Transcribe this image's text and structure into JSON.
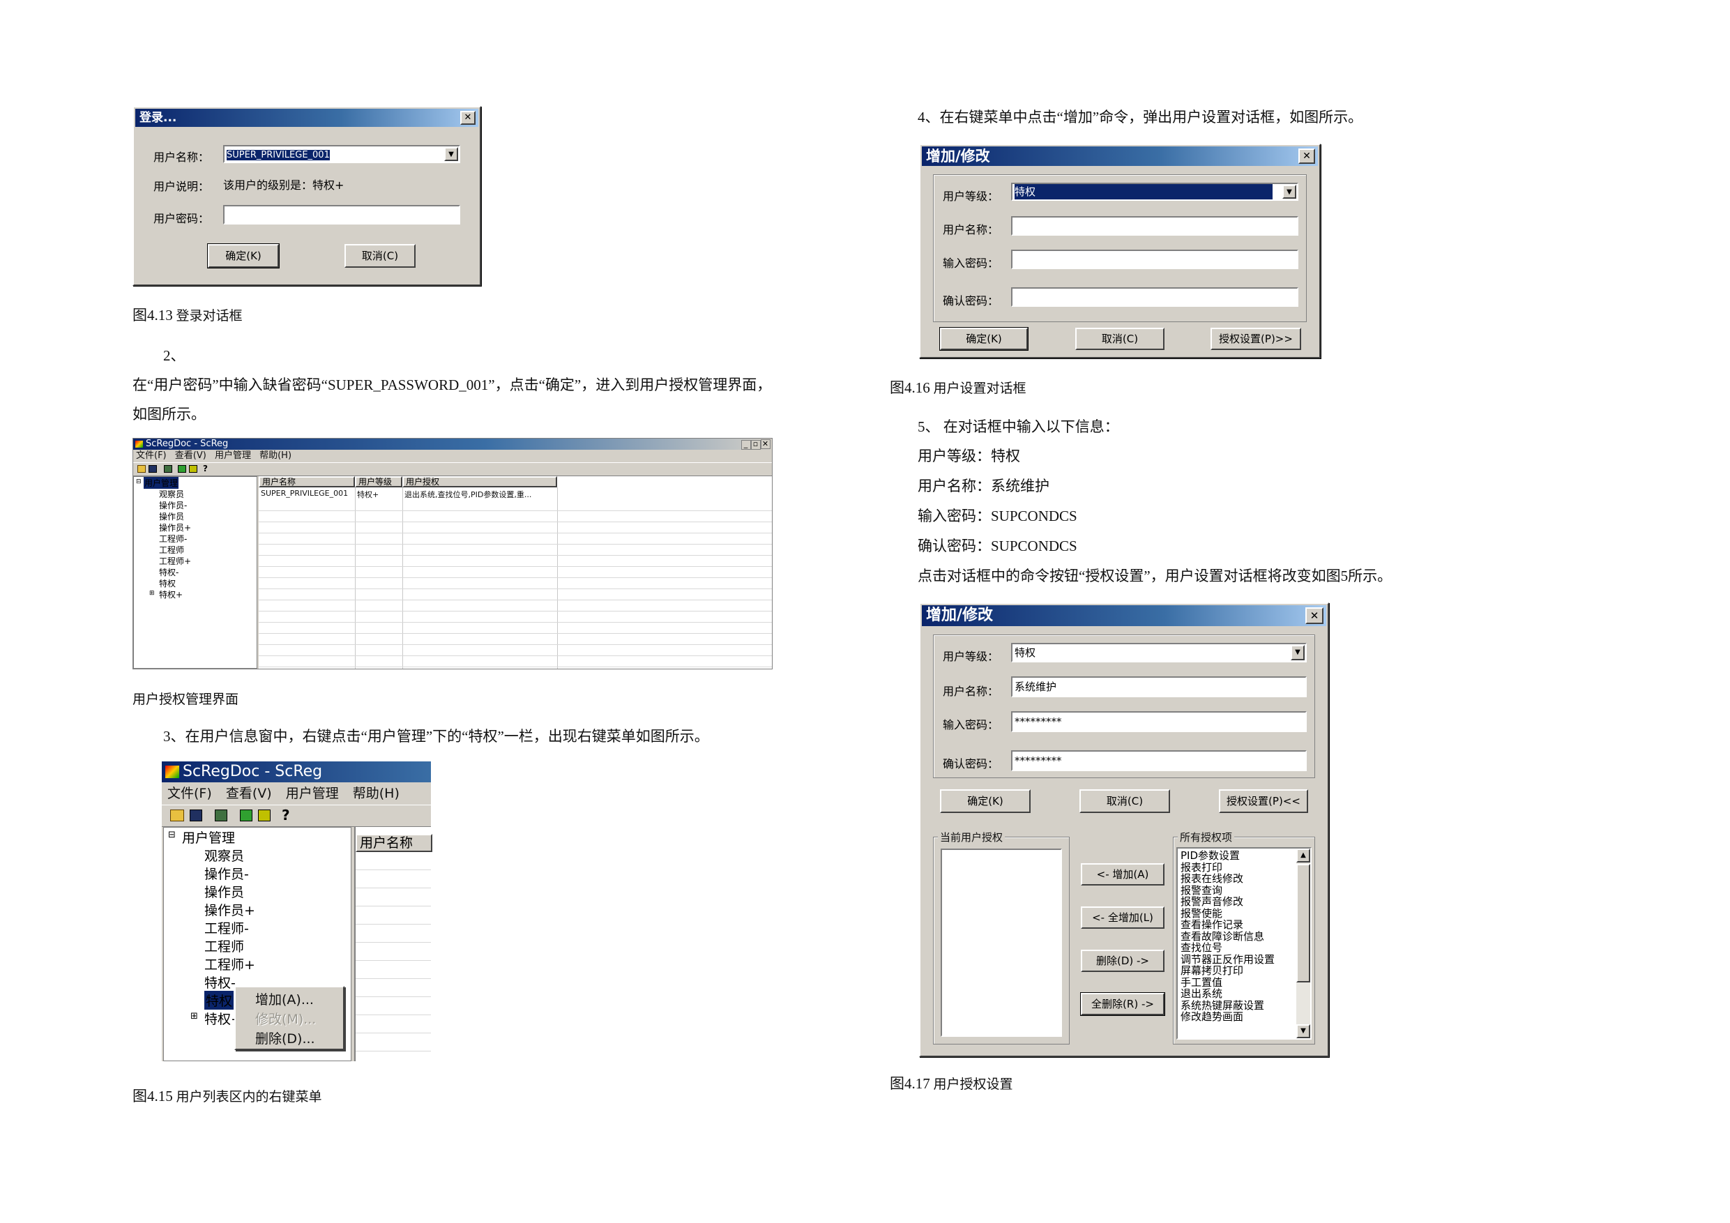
{
  "fig13": {
    "title": "登录...",
    "label_user": "用户名称：",
    "user_value": "SUPER_PRIVILEGE_001",
    "label_desc": "用户说明：",
    "desc_value": "该用户的级别是：特权+",
    "label_pwd": "用户密码：",
    "pwd_value": "",
    "ok": "确定(K)",
    "cancel": "取消(C)",
    "caption_num": "图4.13",
    "caption_text": "登录对话框"
  },
  "step2": {
    "number": "2、",
    "line1": "在“用户密码”中输入缺省密码“SUPER_PASSWORD_001”，点击“确定”，进入到用户授权管理界面，",
    "line2": "如图所示。"
  },
  "fig14": {
    "title": "ScRegDoc - ScReg",
    "menu": [
      "文件(F)",
      "查看(V)",
      "用户管理",
      "帮助(H)"
    ],
    "tree_root": "用户管理",
    "tree_items": [
      "观察员",
      "操作员-",
      "操作员",
      "操作员+",
      "工程师-",
      "工程师",
      "工程师+",
      "特权-",
      "特权",
      "特权+"
    ],
    "columns": [
      "用户名称",
      "用户等级",
      "用户授权"
    ],
    "row": [
      "SUPER_PRIVILEGE_001",
      "特权+",
      "退出系统,查找位号,PID参数设置,重..."
    ],
    "caption": "用户授权管理界面"
  },
  "step3": {
    "text": "3、在用户信息窗中，右键点击“用户管理”下的“特权”一栏，出现右键菜单如图所示。"
  },
  "fig15": {
    "title": "ScRegDoc - ScReg",
    "menu": [
      "文件(F)",
      "查看(V)",
      "用户管理",
      "帮助(H)"
    ],
    "tree_root": "用户管理",
    "tree_items": [
      "观察员",
      "操作员-",
      "操作员",
      "操作员+",
      "工程师-",
      "工程师",
      "工程师+",
      "特权-",
      "特权",
      "特权+"
    ],
    "column": "用户名称",
    "context_menu": [
      "增加(A)...",
      "修改(M)...",
      "删除(D)..."
    ],
    "caption_num": "图4.15",
    "caption_text": "用户列表区内的右键菜单"
  },
  "step4": {
    "text": "4、在右键菜单中点击“增加”命令，弹出用户设置对话框，如图所示。"
  },
  "fig16": {
    "title": "增加/修改",
    "label_level": "用户等级：",
    "level_value": "特权",
    "label_name": "用户名称：",
    "name_value": "",
    "label_pwd": "输入密码：",
    "pwd_value": "",
    "label_confirm": "确认密码：",
    "confirm_value": "",
    "ok": "确定(K)",
    "cancel": "取消(C)",
    "auth": "授权设置(P)>>",
    "caption_num": "图4.16",
    "caption_text": "用户设置对话框"
  },
  "step5": {
    "line1": "5、 在对话框中输入以下信息：",
    "line2": "用户等级：特权",
    "line3": "用户名称：系统维护",
    "line4": "输入密码：SUPCONDCS",
    "line5": "确认密码：SUPCONDCS",
    "line6": "点击对话框中的命令按钮“授权设置”，用户设置对话框将改变如图5所示。"
  },
  "fig17": {
    "title": "增加/修改",
    "label_level": "用户等级：",
    "level_value": "特权",
    "label_name": "用户名称：",
    "name_value": "系统维护",
    "label_pwd": "输入密码：",
    "pwd_value": "*********",
    "label_confirm": "确认密码：",
    "confirm_value": "*********",
    "ok": "确定(K)",
    "cancel": "取消(C)",
    "auth": "授权设置(P)<<",
    "current_group": "当前用户授权",
    "all_group": "所有授权项",
    "add": "<- 增加(A)",
    "add_all": "<- 全增加(L)",
    "remove": "删除(D) ->",
    "remove_all": "全删除(R) ->",
    "auth_items": [
      "PID参数设置",
      "报表打印",
      "报表在线修改",
      "报警查询",
      "报警声音修改",
      "报警使能",
      "查看操作记录",
      "查看故障诊断信息",
      "查找位号",
      "调节器正反作用设置",
      "屏幕拷贝打印",
      "手工置值",
      "退出系统",
      "系统热键屏蔽设置",
      "修改趋势画面"
    ],
    "caption_num": "图4.17",
    "caption_text": "用户授权设置"
  }
}
